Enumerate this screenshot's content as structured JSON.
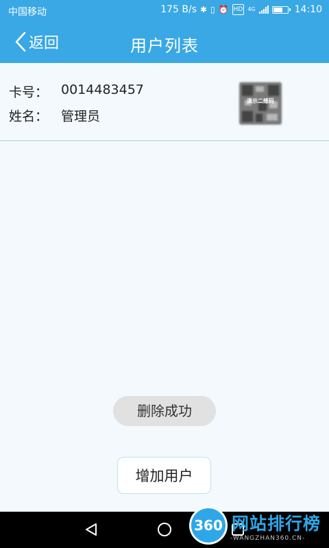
{
  "status_bar": {
    "carrier": "中国移动",
    "speed": "175 B/s",
    "network": "4G",
    "hd": "HD",
    "time": "14:10"
  },
  "header": {
    "back_label": "返回",
    "title": "用户列表"
  },
  "user_list": [
    {
      "card_label": "卡号：",
      "card_value": "0014483457",
      "name_label": "姓名：",
      "name_value": "管理员",
      "qr_caption": "演示二维码"
    }
  ],
  "toast": {
    "message": "删除成功"
  },
  "add_button": {
    "label": "增加用户"
  },
  "watermark": {
    "logo_text": "360",
    "site_name": "网站排行榜",
    "site_url": "-WANGZHAN360.CN-"
  },
  "colors": {
    "header_bg": "#39a8e5",
    "page_bg": "#f3f9fd",
    "watermark": "#2ea7e8"
  },
  "icons": {
    "back": "chevron-left-icon",
    "nav_back": "triangle-back-icon",
    "nav_home": "circle-home-icon",
    "nav_recent": "square-recent-icon"
  }
}
